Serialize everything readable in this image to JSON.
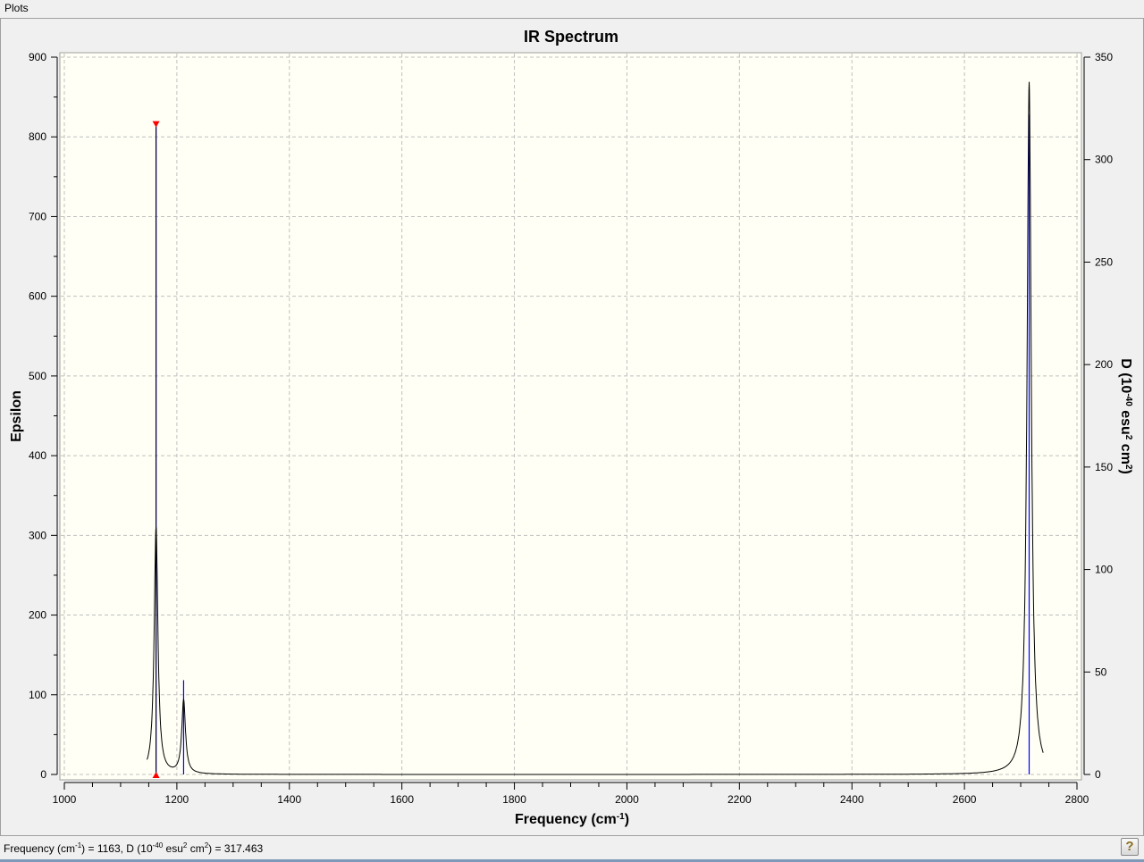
{
  "window": {
    "title": "Plots"
  },
  "status": {
    "text_parts": [
      "Frequency (cm",
      "-1",
      ") = 1163, D (10",
      "-40",
      " esu",
      "2",
      " cm",
      "2",
      ") = 317.463"
    ],
    "help_icon": "question-mark-icon",
    "help_label": "?"
  },
  "chart_data": {
    "type": "line",
    "title": "IR Spectrum",
    "xlabel": "Frequency (cm-1)",
    "ylabel": "Epsilon",
    "y2label": "D (10-40 esu2 cm2)",
    "xlabel_parts": [
      "Frequency (cm",
      "-1",
      ")"
    ],
    "y2label_parts": [
      "D (10",
      "-40",
      " esu",
      "2",
      " cm",
      "2",
      ")"
    ],
    "xlim": [
      1000,
      2800
    ],
    "ylim": [
      0,
      900
    ],
    "y2lim": [
      0,
      350
    ],
    "xticks": [
      1000,
      1200,
      1400,
      1600,
      1800,
      2000,
      2200,
      2400,
      2600,
      2800
    ],
    "yticks": [
      0,
      100,
      200,
      300,
      400,
      500,
      600,
      700,
      800,
      900
    ],
    "y2ticks": [
      0,
      50,
      100,
      150,
      200,
      250,
      300,
      350
    ],
    "grid": true,
    "curve_range": [
      1147,
      2740
    ],
    "peaks": [
      {
        "freq": 1163,
        "epsilon": 310,
        "D": 317.463,
        "hwhm": 4,
        "selected": true
      },
      {
        "freq": 1212,
        "epsilon": 92,
        "D": 46,
        "hwhm": 4,
        "selected": false
      },
      {
        "freq": 2715,
        "epsilon": 869,
        "D": 322,
        "hwhm": 4.5,
        "selected": false
      }
    ],
    "colors": {
      "curve": "#000000",
      "stick": "#0000ff",
      "marker": "#ff0000",
      "plot_bg": "#fffff5",
      "grid": "#c0c0c0"
    }
  }
}
